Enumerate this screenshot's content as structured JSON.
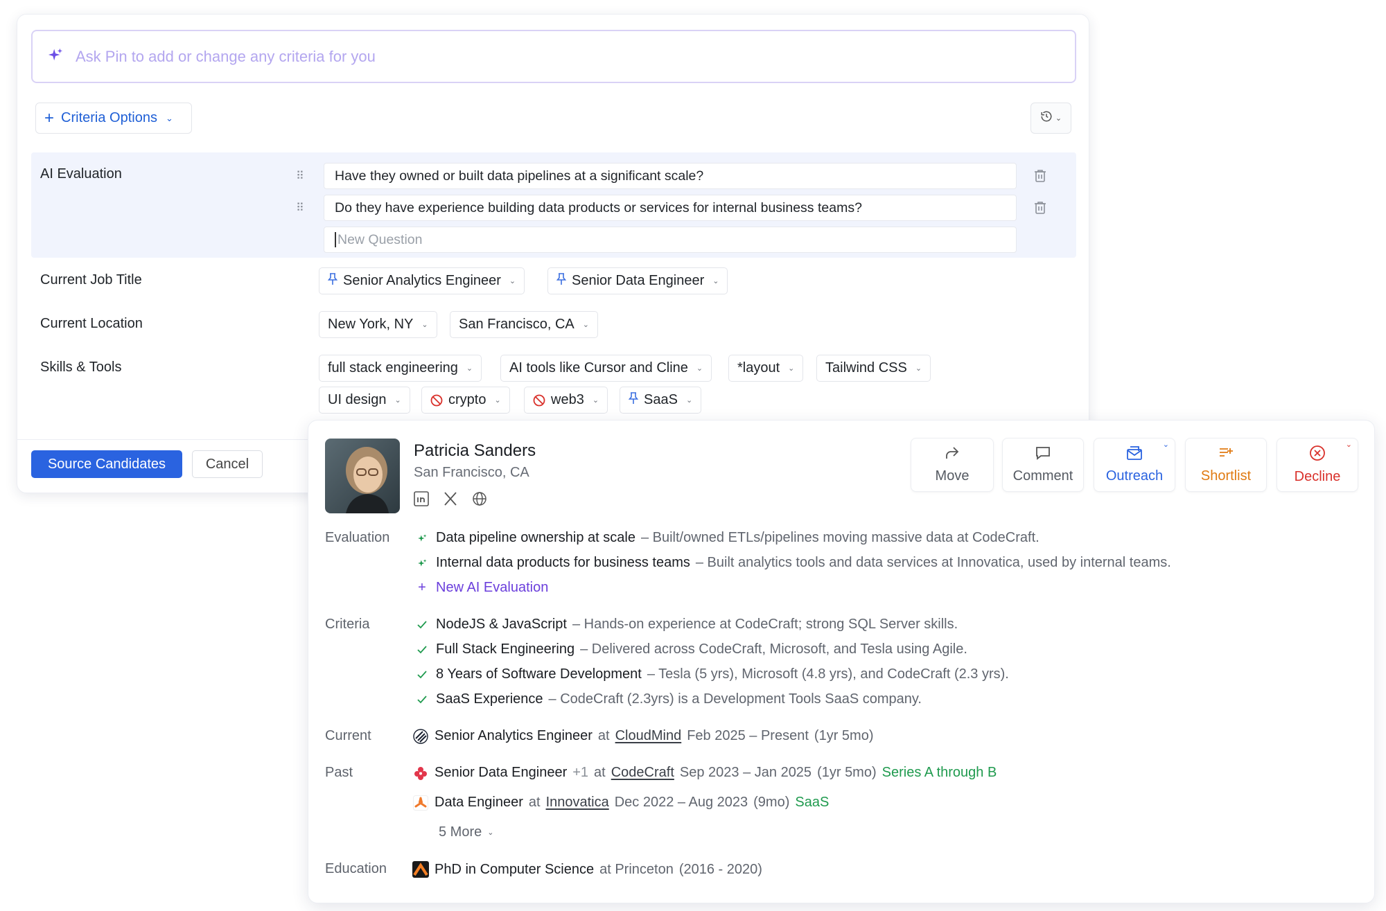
{
  "pin": {
    "placeholder": "Ask Pin to add or change any criteria for you"
  },
  "criteria_options_label": "Criteria Options",
  "ai_evaluation": {
    "label": "AI Evaluation",
    "questions": [
      "Have they owned or built data pipelines at a significant scale?",
      "Do they have experience building data products or services for internal business teams?"
    ],
    "new_question_placeholder": "New Question"
  },
  "job_title": {
    "label": "Current Job Title",
    "chips": [
      "Senior Analytics Engineer",
      "Senior Data Engineer"
    ]
  },
  "location": {
    "label": "Current Location",
    "chips": [
      "New York, NY",
      "San Francisco, CA"
    ]
  },
  "skills": {
    "label": "Skills & Tools",
    "chips": [
      "full stack engineering",
      "AI tools like Cursor and Cline",
      "*layout",
      "Tailwind CSS",
      "UI design",
      "crypto",
      "web3",
      "SaaS"
    ]
  },
  "footer": {
    "source_label": "Source Candidates",
    "cancel_label": "Cancel"
  },
  "candidate": {
    "name": "Patricia Sanders",
    "location": "San Francisco, CA",
    "actions": [
      "Move",
      "Comment",
      "Outreach",
      "Shortlist",
      "Decline"
    ],
    "evaluation": {
      "label": "Evaluation",
      "items": [
        {
          "title": "Data pipeline ownership at scale",
          "desc": "– Built/owned ETLs/pipelines moving massive data at CodeCraft."
        },
        {
          "title": "Internal data products for business teams",
          "desc": "– Built analytics tools and data services at Innovatica, used by internal teams."
        }
      ],
      "new_label": "New AI Evaluation"
    },
    "criteria": {
      "label": "Criteria",
      "items": [
        {
          "title": "NodeJS & JavaScript",
          "desc": "– Hands-on experience at CodeCraft; strong SQL Server skills."
        },
        {
          "title": "Full Stack Engineering",
          "desc": "– Delivered across CodeCraft, Microsoft, and Tesla using Agile."
        },
        {
          "title": "8 Years of Software Development",
          "desc": "– Tesla (5 yrs), Microsoft (4.8 yrs), and CodeCraft (2.3 yrs)."
        },
        {
          "title": "SaaS Experience",
          "desc": "– CodeCraft (2.3yrs) is a Development Tools SaaS company."
        }
      ]
    },
    "current": {
      "label": "Current",
      "title": "Senior Analytics Engineer",
      "at": "at",
      "company": "CloudMind",
      "dates": "Feb 2025 – Present",
      "duration": "(1yr 5mo)"
    },
    "past": {
      "label": "Past",
      "jobs": [
        {
          "title": "Senior Data Engineer",
          "extra": "+1",
          "at": "at",
          "company": "CodeCraft",
          "dates": "Sep 2023 – Jan 2025",
          "duration": "(1yr 5mo)",
          "tag": "Series A through B"
        },
        {
          "title": "Data Engineer",
          "extra": "",
          "at": "at",
          "company": "Innovatica",
          "dates": "Dec 2022 – Aug 2023",
          "duration": "(9mo)",
          "tag": "SaaS"
        }
      ],
      "more": "5 More"
    },
    "education": {
      "label": "Education",
      "degree": "PhD in Computer Science",
      "school": "at Princeton",
      "years": "(2016 - 2020)"
    }
  },
  "colors": {
    "accent": "#2a63e0",
    "ai_purple": "#6b3fdc",
    "green": "#1f9a4e",
    "shortlist": "#e07a12",
    "decline": "#d9312b"
  }
}
